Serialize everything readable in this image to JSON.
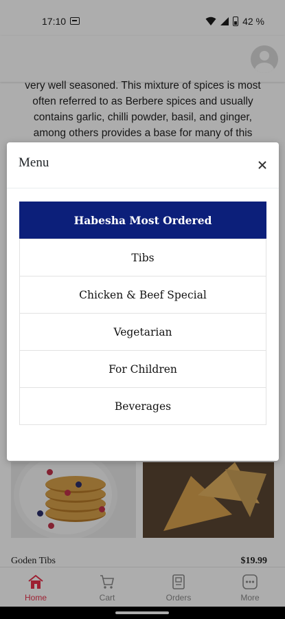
{
  "status_bar": {
    "time": "17:10",
    "battery": "42 %"
  },
  "description": "very well seasoned. This mixture of spices is most often referred to as Berbere spices and usually contains garlic, chilli powder, basil, and ginger, among others provides a base for many of this using dishes. At Habesha",
  "featured_item": {
    "name": "Goden Tibs",
    "price": "$19.99"
  },
  "modal": {
    "title": "Menu",
    "close_label": "×",
    "items": [
      {
        "label": "Habesha Most Ordered",
        "active": true
      },
      {
        "label": "Tibs",
        "active": false
      },
      {
        "label": "Chicken & Beef Special",
        "active": false
      },
      {
        "label": "Vegetarian",
        "active": false
      },
      {
        "label": "For Children",
        "active": false
      },
      {
        "label": "Beverages",
        "active": false
      }
    ]
  },
  "bottom_nav": {
    "items": [
      {
        "label": "Home",
        "icon": "home-icon",
        "active": true
      },
      {
        "label": "Cart",
        "icon": "cart-icon",
        "active": false
      },
      {
        "label": "Orders",
        "icon": "orders-icon",
        "active": false
      },
      {
        "label": "More",
        "icon": "more-icon",
        "active": false
      }
    ]
  },
  "colors": {
    "accent": "#e8304a",
    "active_menu_bg": "#0c1f7a",
    "nav_inactive": "#8a8a8a",
    "overlay": "rgba(0,0,0,0.32)"
  }
}
